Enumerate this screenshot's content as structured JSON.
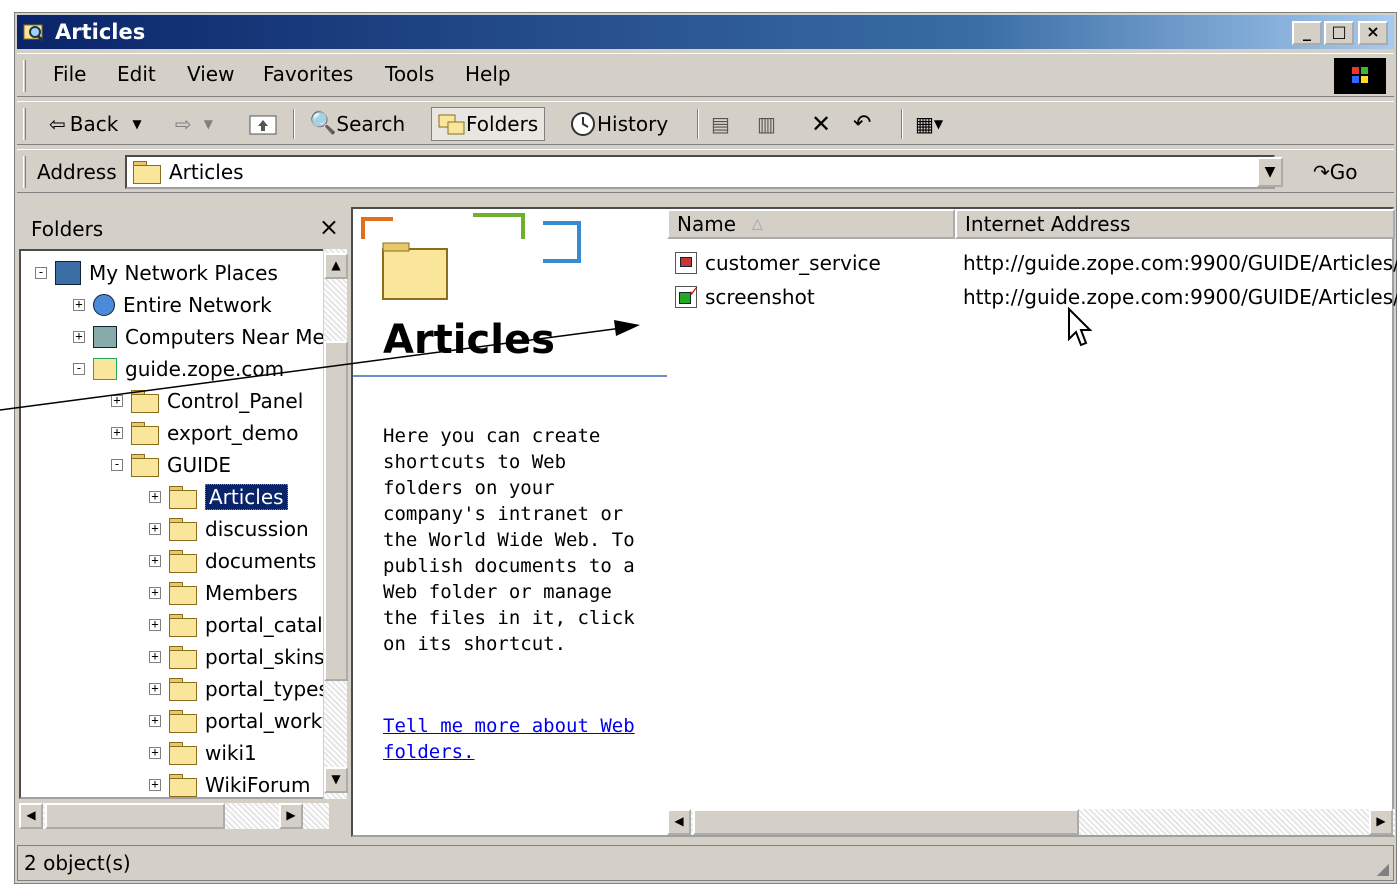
{
  "window": {
    "title": "Articles"
  },
  "menu": [
    "File",
    "Edit",
    "View",
    "Favorites",
    "Tools",
    "Help"
  ],
  "toolbar": {
    "back": "Back",
    "search": "Search",
    "folders": "Folders",
    "history": "History"
  },
  "address": {
    "label": "Address",
    "value": "Articles",
    "go": "Go"
  },
  "folders_pane": {
    "title": "Folders",
    "close": "×",
    "tree": [
      {
        "label": "My Network Places",
        "level": 0,
        "expander": "-"
      },
      {
        "label": "Entire Network",
        "level": 1,
        "expander": "+"
      },
      {
        "label": "Computers Near Me",
        "level": 1,
        "expander": "+"
      },
      {
        "label": "guide.zope.com",
        "level": 1,
        "expander": "-"
      },
      {
        "label": "Control_Panel",
        "level": 2,
        "expander": "+"
      },
      {
        "label": "export_demo",
        "level": 2,
        "expander": "+"
      },
      {
        "label": "GUIDE",
        "level": 2,
        "expander": "-"
      },
      {
        "label": "Articles",
        "level": 3,
        "expander": "+",
        "selected": true
      },
      {
        "label": "discussion",
        "level": 3,
        "expander": "+"
      },
      {
        "label": "documents",
        "level": 3,
        "expander": "+"
      },
      {
        "label": "Members",
        "level": 3,
        "expander": "+"
      },
      {
        "label": "portal_catalog",
        "level": 3,
        "expander": "+"
      },
      {
        "label": "portal_skins",
        "level": 3,
        "expander": "+"
      },
      {
        "label": "portal_types",
        "level": 3,
        "expander": "+"
      },
      {
        "label": "portal_workflow",
        "level": 3,
        "expander": "+"
      },
      {
        "label": "wiki1",
        "level": 3,
        "expander": "+"
      },
      {
        "label": "WikiForum",
        "level": 3,
        "expander": "+"
      }
    ]
  },
  "webview": {
    "heading": "Articles",
    "description": "Here you can create shortcuts to Web folders on your company's intranet or the World Wide Web. To publish documents to a Web folder or manage the files in it, click on its shortcut.",
    "link": "Tell me more about Web folders."
  },
  "list": {
    "columns": [
      "Name",
      "Internet Address"
    ],
    "rows": [
      {
        "name": "customer_service",
        "address": "http://guide.zope.com:9900/GUIDE/Articles/"
      },
      {
        "name": "screenshot",
        "address": "http://guide.zope.com:9900/GUIDE/Articles/"
      }
    ]
  },
  "status": {
    "text": "2 object(s)"
  },
  "colors": {
    "title_start": "#0a246a",
    "title_end": "#a6caf0",
    "face": "#d4d0c8",
    "selection": "#0a246a"
  }
}
